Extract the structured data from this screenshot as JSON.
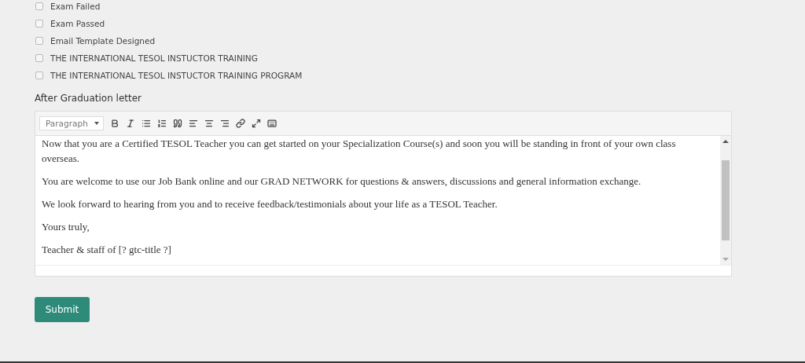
{
  "checklist": [
    {
      "label": "Exam Failed",
      "checked": false
    },
    {
      "label": "Exam Passed",
      "checked": false
    },
    {
      "label": "Email Template Designed",
      "checked": false
    },
    {
      "label": "THE INTERNATIONAL TESOL INSTUCTOR TRAINING",
      "checked": false
    },
    {
      "label": "THE INTERNATIONAL TESOL INSTUCTOR TRAINING PROGRAM",
      "checked": false
    }
  ],
  "editor": {
    "label": "After Graduation letter",
    "format": "Paragraph",
    "paragraphs": [
      "Now that you are a Certified TESOL Teacher you can get started on your Specialization Course(s) and soon you will be standing in front of your own class overseas.",
      "You are welcome to use our Job Bank online and our GRAD NETWORK for questions & answers, discussions and general information exchange.",
      "We look forward to hearing from you and to receive feedback/testimonials about your life as a TESOL Teacher.",
      "Yours truly,",
      "Teacher & staff of [? gtc-title ?]"
    ]
  },
  "submit": "Submit"
}
